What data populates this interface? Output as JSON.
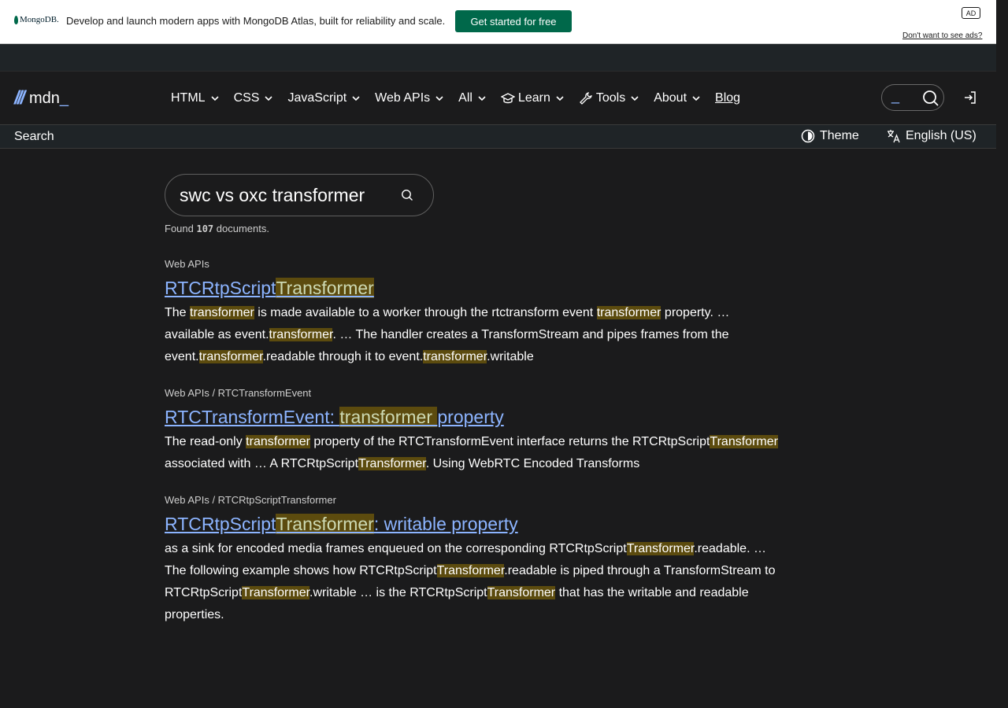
{
  "ad": {
    "logo_text": "MongoDB.",
    "text": "Develop and launch modern apps with MongoDB Atlas, built for reliability and scale.",
    "cta": "Get started for free",
    "badge": "AD",
    "dismiss": "Don't want to see ads?"
  },
  "brand": {
    "name": "mdn",
    "cursor": "_"
  },
  "nav": {
    "items": [
      {
        "label": "HTML"
      },
      {
        "label": "CSS"
      },
      {
        "label": "JavaScript"
      },
      {
        "label": "Web APIs"
      },
      {
        "label": "All"
      },
      {
        "label": "Learn",
        "icon": "graduation-cap-icon"
      },
      {
        "label": "Tools",
        "icon": "wrench-icon"
      },
      {
        "label": "About"
      }
    ],
    "blog": "Blog",
    "search_cursor": "_"
  },
  "subheader": {
    "label": "Search",
    "theme": "Theme",
    "language": "English (US)"
  },
  "search": {
    "query": "swc vs oxc transformer",
    "found_prefix": "Found ",
    "found_count": "107",
    "found_suffix": " documents."
  },
  "results": [
    {
      "breadcrumb": "Web APIs",
      "title": [
        {
          "t": "RTCRtpScript",
          "h": false
        },
        {
          "t": "Transformer",
          "h": true
        }
      ],
      "description": [
        {
          "t": "The ",
          "h": false
        },
        {
          "t": "transformer",
          "h": true
        },
        {
          "t": " is made available to a worker through the rtctransform event ",
          "h": false
        },
        {
          "t": "transformer",
          "h": true
        },
        {
          "t": " property. … available as event.",
          "h": false
        },
        {
          "t": "transformer",
          "h": true
        },
        {
          "t": ". … The handler creates a TransformStream and pipes frames from the event.",
          "h": false
        },
        {
          "t": "transformer",
          "h": true
        },
        {
          "t": ".readable through it to event.",
          "h": false
        },
        {
          "t": "transformer",
          "h": true
        },
        {
          "t": ".writable",
          "h": false
        }
      ]
    },
    {
      "breadcrumb": "Web APIs / RTCTransformEvent",
      "title": [
        {
          "t": "RTCTransformEvent: ",
          "h": false
        },
        {
          "t": "transformer ",
          "h": true
        },
        {
          "t": "property",
          "h": false
        }
      ],
      "description": [
        {
          "t": "The read-only ",
          "h": false
        },
        {
          "t": "transformer",
          "h": true
        },
        {
          "t": " property of the RTCTransformEvent interface returns the RTCRtpScript",
          "h": false
        },
        {
          "t": "Transformer",
          "h": true
        },
        {
          "t": " associated with … A RTCRtpScript",
          "h": false
        },
        {
          "t": "Transformer",
          "h": true
        },
        {
          "t": ". Using WebRTC Encoded Transforms",
          "h": false
        }
      ]
    },
    {
      "breadcrumb": "Web APIs / RTCRtpScriptTransformer",
      "title": [
        {
          "t": "RTCRtpScript",
          "h": false
        },
        {
          "t": "Transformer",
          "h": true
        },
        {
          "t": ": writable property",
          "h": false
        }
      ],
      "description": [
        {
          "t": "as a sink for encoded media frames enqueued on the corresponding RTCRtpScript",
          "h": false
        },
        {
          "t": "Transformer",
          "h": true
        },
        {
          "t": ".readable. … The following example shows how RTCRtpScript",
          "h": false
        },
        {
          "t": "Transformer",
          "h": true
        },
        {
          "t": ".readable is piped through a TransformStream to RTCRtpScript",
          "h": false
        },
        {
          "t": "Transformer",
          "h": true
        },
        {
          "t": ".writable … is the RTCRtpScript",
          "h": false
        },
        {
          "t": "Transformer",
          "h": true
        },
        {
          "t": " that has the writable and readable properties.",
          "h": false
        }
      ]
    }
  ]
}
